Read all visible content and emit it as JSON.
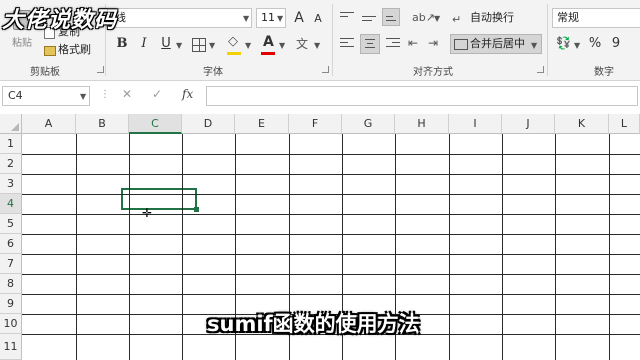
{
  "watermark": "大佬说数码",
  "clipboard": {
    "paste_label": "粘贴",
    "copy_label": "复制",
    "format_painter_label": "格式刷",
    "group_label": "剪贴板"
  },
  "font": {
    "font_name": "线",
    "font_size": "11",
    "grow_icon": "A",
    "shrink_icon": "A",
    "bold": "B",
    "italic": "I",
    "underline": "U",
    "group_label": "字体",
    "wen_label": "文"
  },
  "alignment": {
    "wrap_label": "自动换行",
    "merge_label": "合并后居中",
    "group_label": "对齐方式"
  },
  "number": {
    "format_value": "常规",
    "percent": "%",
    "comma": "9",
    "group_label": "数字"
  },
  "formula_bar": {
    "name_box": "C4",
    "cancel_icon": "✕",
    "enter_icon": "✓",
    "fx_icon": "fx",
    "formula": ""
  },
  "sheet": {
    "columns": [
      "A",
      "B",
      "C",
      "D",
      "E",
      "F",
      "G",
      "H",
      "I",
      "J",
      "K",
      "L"
    ],
    "rows": [
      "1",
      "2",
      "3",
      "4",
      "5",
      "6",
      "7",
      "8",
      "9",
      "10",
      "11"
    ],
    "selected_cell": "C4"
  },
  "subtitle": "sumif函数的使用方法",
  "colors": {
    "accent": "#217346",
    "font_color_bar": "#e00000",
    "fill_color_bar": "#f5d000"
  }
}
